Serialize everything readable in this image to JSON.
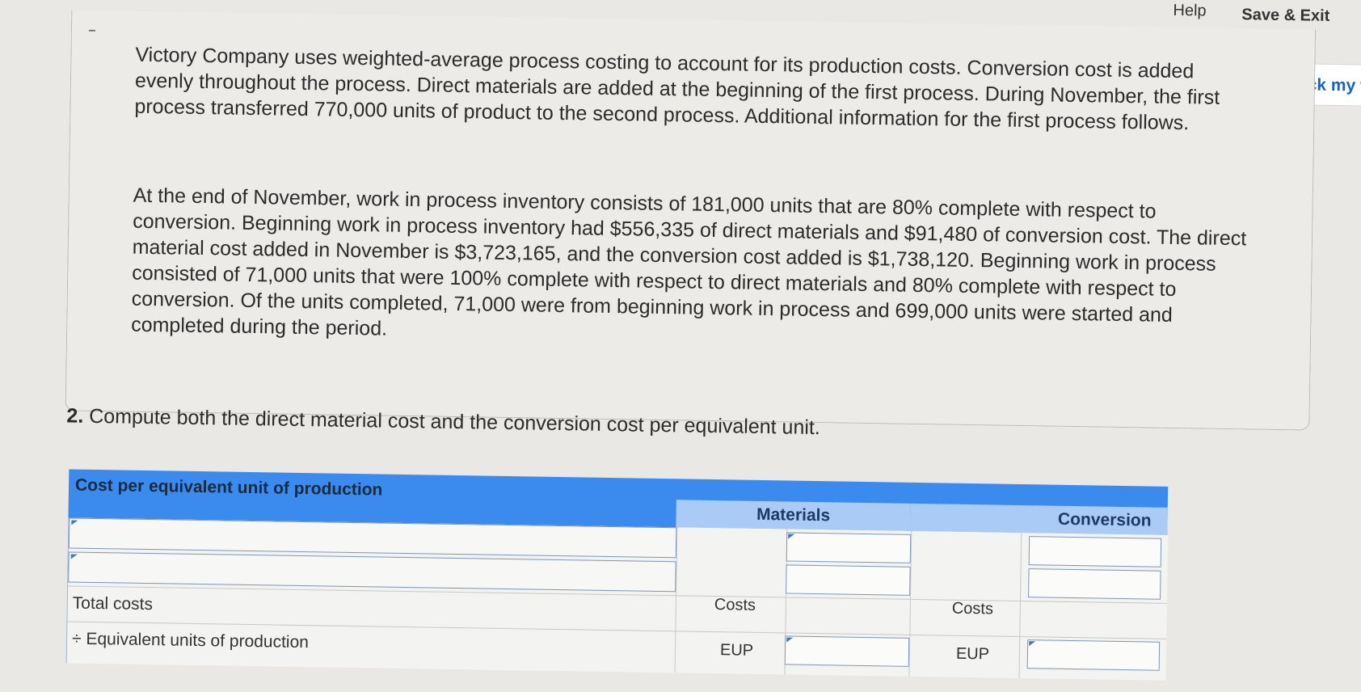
{
  "header": {
    "help_label": "Help",
    "save_exit_label": "Save & Exit",
    "check_label": "Check my work"
  },
  "problem": {
    "paragraph_1": "Victory Company uses weighted-average process costing to account for its production costs. Conversion cost is added evenly throughout the process. Direct materials are added at the beginning of the first process. During November, the first process transferred 770,000 units of product to the second process. Additional information for the first process follows.",
    "paragraph_2": "At the end of November, work in process inventory consists of 181,000 units that are 80% complete with respect to conversion. Beginning work in process inventory had $556,335 of direct materials and $91,480 of conversion cost. The direct material cost added in November is $3,723,165, and the conversion cost added is $1,738,120. Beginning work in process consisted of 71,000 units that were 100% complete with respect to direct materials and 80% complete with respect to conversion. Of the units completed, 71,000 were from beginning work in process and 699,000 units were started and completed during the period."
  },
  "question": {
    "number": "2.",
    "text": "Compute both the direct material cost and the conversion cost per equivalent unit."
  },
  "table": {
    "title": "Cost per equivalent unit of production",
    "col_materials": "Materials",
    "col_conversion": "Conversion",
    "row_total_costs": "Total costs",
    "row_equivalent_units": "÷ Equivalent units of production",
    "costs_label": "Costs",
    "eup_label": "EUP",
    "row1_label_value": "",
    "row2_label_value": "",
    "materials_row1_value": "",
    "materials_row2_value": "",
    "materials_eup_value": "",
    "conversion_row1_value": "",
    "conversion_row2_value": "",
    "conversion_eup_value": ""
  },
  "colors": {
    "header_blue": "#3b8bef",
    "subheader_blue": "#a9cbf6",
    "link_blue": "#1565c0",
    "input_border": "#7d95b8"
  }
}
